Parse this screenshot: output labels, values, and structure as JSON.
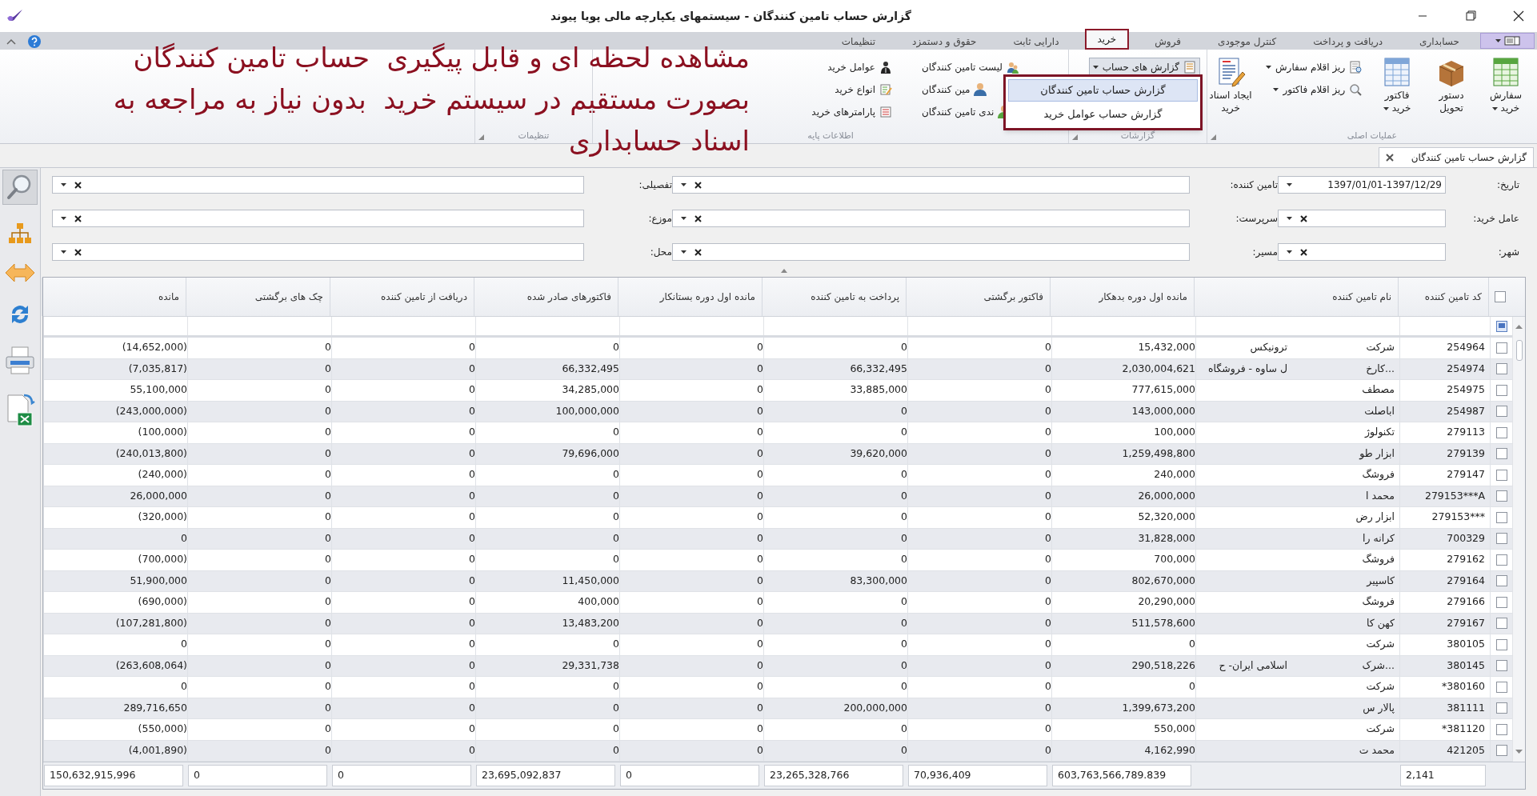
{
  "window": {
    "title": "گزارش حساب تامین کنندگان - سیستمهای یکپارچه مالی پویا پیوند"
  },
  "ribbon_tabs": [
    {
      "label": "حسابداری",
      "selected": false
    },
    {
      "label": "دریافت و پرداخت",
      "selected": false
    },
    {
      "label": "کنترل موجودی",
      "selected": false
    },
    {
      "label": "فروش",
      "selected": false
    },
    {
      "label": "خرید",
      "selected": true
    },
    {
      "label": "دارایی ثابت",
      "selected": false
    },
    {
      "label": "حقوق و دستمزد",
      "selected": false
    },
    {
      "label": "تنظیمات",
      "selected": false
    }
  ],
  "ribbon_groups": [
    {
      "label": "عملیات اصلی",
      "launcher": true,
      "columns": [
        {
          "kind": "large",
          "items": [
            {
              "label": "سفارش خرید",
              "dropdown": true,
              "expanded": false
            }
          ]
        },
        {
          "kind": "large",
          "items": [
            {
              "label": "دستور تحویل",
              "dropdown": false,
              "expanded": false
            }
          ]
        },
        {
          "kind": "large",
          "items": [
            {
              "label": "فاکتور خرید",
              "dropdown": true,
              "expanded": false
            }
          ]
        },
        {
          "kind": "small",
          "items": [
            {
              "label": "ریز اقلام سفارش",
              "dropdown": true,
              "expanded": false
            },
            {
              "label": "ریز اقلام فاکتور",
              "dropdown": true,
              "expanded": false
            }
          ]
        },
        {
          "kind": "large",
          "items": [
            {
              "label": "ایجاد اسناد خرید",
              "dropdown": false,
              "expanded": false
            }
          ]
        }
      ]
    },
    {
      "label": "گزارشات",
      "launcher": true,
      "columns": [
        {
          "kind": "small",
          "items": [
            {
              "label": "گزارش های حساب",
              "dropdown": true,
              "expanded": true
            }
          ]
        }
      ]
    },
    {
      "label": "اطلاعات پایه",
      "launcher": false,
      "columns": [
        {
          "kind": "small",
          "items": [
            {
              "label": "لیست تامین کنندگان",
              "dropdown": false,
              "expanded": false
            },
            {
              "label": "مین کنندگان",
              "dropdown": false,
              "expanded": false
            },
            {
              "label": "ندی تامین کنندگان",
              "dropdown": false,
              "expanded": false
            }
          ]
        },
        {
          "kind": "small",
          "items": [
            {
              "label": "عوامل خرید",
              "dropdown": false,
              "expanded": false
            },
            {
              "label": "انواع خرید",
              "dropdown": false,
              "expanded": false
            },
            {
              "label": "پارامترهای خرید",
              "dropdown": false,
              "expanded": false
            }
          ]
        }
      ]
    },
    {
      "label": "تنظیمات",
      "launcher": true
    }
  ],
  "report_menu": {
    "items": [
      {
        "label": "گزارش حساب تامین کنندگان",
        "selected": true
      },
      {
        "label": "گزارش حساب عوامل خرید",
        "selected": false
      }
    ]
  },
  "annotation": {
    "lines": [
      "مشاهده لحظه ای و قابل پیگیری  حساب تامین کنندگان",
      "بصورت مستقیم در سیستم خرید  بدون نیاز به مراجعه به",
      "اسناد حسابداری"
    ]
  },
  "document_tabs": [
    {
      "label": "گزارش حساب تامین کنندگان",
      "selected": true
    }
  ],
  "filters": [
    [
      {
        "label": "تاریخ:",
        "value": "1397/01/01-1397/12/29",
        "clearable": false
      },
      {
        "label": "تامین کننده:",
        "clearable": true
      },
      {
        "label": "تفصیلی:",
        "clearable": true
      }
    ],
    [
      {
        "label": "عامل خرید:",
        "clearable": true
      },
      {
        "label": "سرپرست:",
        "clearable": true
      },
      {
        "label": "موزع:",
        "clearable": true
      }
    ],
    [
      {
        "label": "شهر:",
        "clearable": true
      },
      {
        "label": "مسیر:",
        "clearable": true
      },
      {
        "label": "محل:",
        "clearable": true
      }
    ]
  ],
  "table": {
    "header_checked": false,
    "columns": [
      "کد تامین کننده",
      "نام تامین کننده",
      "مانده اول دوره بدهکار",
      "فاکتور برگشتی",
      "پرداخت به تامین کننده",
      "مانده اول دوره بستانکار",
      "فاکتورهای صادر شده",
      "دریافت از تامین کننده",
      "چک های برگشتی",
      "مانده"
    ],
    "rows": [
      {
        "checked": false,
        "code": "254964",
        "name": "شرکت",
        "name_tail": "ترونیکس",
        "values": [
          "15,432,000",
          "0",
          "0",
          "0",
          "0",
          "0",
          "0",
          "(14,652,000)"
        ]
      },
      {
        "checked": false,
        "code": "254974",
        "name": "...کارخ",
        "name_tail": "ل ساوه - فروشگاه",
        "values": [
          "2,030,004,621",
          "0",
          "66,332,495",
          "0",
          "66,332,495",
          "0",
          "0",
          "(7,035,817)"
        ]
      },
      {
        "checked": false,
        "code": "254975",
        "name": "مصطف",
        "values": [
          "777,615,000",
          "0",
          "33,885,000",
          "0",
          "34,285,000",
          "0",
          "0",
          "55,100,000"
        ]
      },
      {
        "checked": false,
        "code": "254987",
        "name": "اباصلت",
        "values": [
          "143,000,000",
          "0",
          "0",
          "0",
          "100,000,000",
          "0",
          "0",
          "(243,000,000)"
        ]
      },
      {
        "checked": false,
        "code": "279113",
        "name": "تکنولوژ",
        "values": [
          "100,000",
          "0",
          "0",
          "0",
          "0",
          "0",
          "0",
          "(100,000)"
        ]
      },
      {
        "checked": false,
        "code": "279139",
        "name": "ابزار طو",
        "values": [
          "1,259,498,800",
          "0",
          "39,620,000",
          "0",
          "79,696,000",
          "0",
          "0",
          "(240,013,800)"
        ]
      },
      {
        "checked": false,
        "code": "279147",
        "name": "فروشگ",
        "values": [
          "240,000",
          "0",
          "0",
          "0",
          "0",
          "0",
          "0",
          "(240,000)"
        ]
      },
      {
        "checked": false,
        "code": "279153***A",
        "name": "محمد ا",
        "values": [
          "26,000,000",
          "0",
          "0",
          "0",
          "0",
          "0",
          "0",
          "26,000,000"
        ]
      },
      {
        "checked": false,
        "code": "279153***",
        "name": "ابزار رض",
        "values": [
          "52,320,000",
          "0",
          "0",
          "0",
          "0",
          "0",
          "0",
          "(320,000)"
        ]
      },
      {
        "checked": false,
        "code": "700329",
        "name": "کرانه را",
        "values": [
          "31,828,000",
          "0",
          "0",
          "0",
          "0",
          "0",
          "0",
          "0"
        ]
      },
      {
        "checked": false,
        "code": "279162",
        "name": "فروشگ",
        "values": [
          "700,000",
          "0",
          "0",
          "0",
          "0",
          "0",
          "0",
          "(700,000)"
        ]
      },
      {
        "checked": false,
        "code": "279164",
        "name": "کاسپیر",
        "values": [
          "802,670,000",
          "0",
          "83,300,000",
          "0",
          "11,450,000",
          "0",
          "0",
          "51,900,000"
        ]
      },
      {
        "checked": false,
        "code": "279166",
        "name": "فروشگ",
        "values": [
          "20,290,000",
          "0",
          "0",
          "0",
          "400,000",
          "0",
          "0",
          "(690,000)"
        ]
      },
      {
        "checked": false,
        "code": "279167",
        "name": "کهن کا",
        "values": [
          "511,578,600",
          "0",
          "0",
          "0",
          "13,483,200",
          "0",
          "0",
          "(107,281,800)"
        ]
      },
      {
        "checked": false,
        "code": "380105",
        "name": "شرکت",
        "values": [
          "0",
          "0",
          "0",
          "0",
          "0",
          "0",
          "0",
          "0"
        ]
      },
      {
        "checked": false,
        "code": "380145",
        "name": "...شرک",
        "name_tail": "اسلامی ایران- ح",
        "values": [
          "290,518,226",
          "0",
          "0",
          "0",
          "29,331,738",
          "0",
          "0",
          "(263,608,064)"
        ]
      },
      {
        "checked": false,
        "code": "*380160",
        "name": "شرکت",
        "values": [
          "0",
          "0",
          "0",
          "0",
          "0",
          "0",
          "0",
          "0"
        ]
      },
      {
        "checked": false,
        "code": "381111",
        "name": "پالار س",
        "values": [
          "1,399,673,200",
          "0",
          "200,000,000",
          "0",
          "0",
          "0",
          "0",
          "289,716,650"
        ]
      },
      {
        "checked": false,
        "code": "*381120",
        "name": "شرکت",
        "values": [
          "550,000",
          "0",
          "0",
          "0",
          "0",
          "0",
          "0",
          "(550,000)"
        ]
      },
      {
        "checked": false,
        "code": "421205",
        "name": "محمد ت",
        "values": [
          "4,162,990",
          "0",
          "0",
          "0",
          "0",
          "0",
          "0",
          "(4,001,890)"
        ]
      }
    ],
    "totals": {
      "count": "2,141",
      "values": [
        "603,763,566,789.839",
        "70,936,409",
        "23,265,328,766",
        "0",
        "23,695,092,837",
        "0",
        "0",
        "150,632,915,996"
      ]
    }
  }
}
